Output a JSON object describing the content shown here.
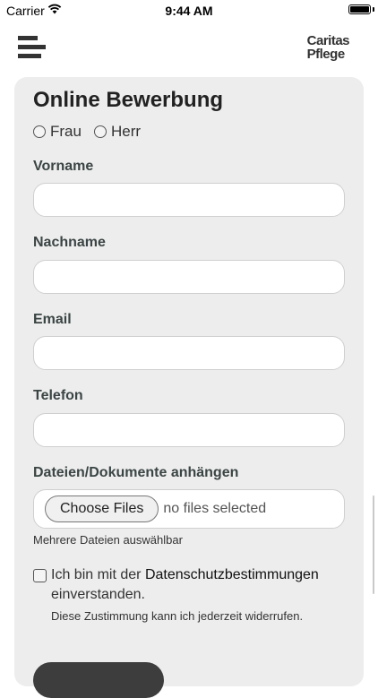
{
  "status_bar": {
    "carrier": "Carrier",
    "time": "9:44 AM"
  },
  "header": {
    "logo_line1": "Caritas",
    "logo_line2": "Pflege"
  },
  "form": {
    "title": "Online Bewerbung",
    "gender_options": [
      "Frau",
      "Herr"
    ],
    "fields": {
      "vorname": "Vorname",
      "nachname": "Nachname",
      "email": "Email",
      "telefon": "Telefon"
    },
    "attachments": {
      "label": "Dateien/Dokumente anhängen",
      "button": "Choose Files",
      "status": "no files selected",
      "hint": "Mehrere Dateien auswählbar"
    },
    "consent": {
      "text_before": "Ich bin mit der ",
      "link": "Datenschutzbestimmungen",
      "text_after": " einverstanden.",
      "note": "Diese Zustimmung kann ich jederzeit widerrufen."
    }
  }
}
